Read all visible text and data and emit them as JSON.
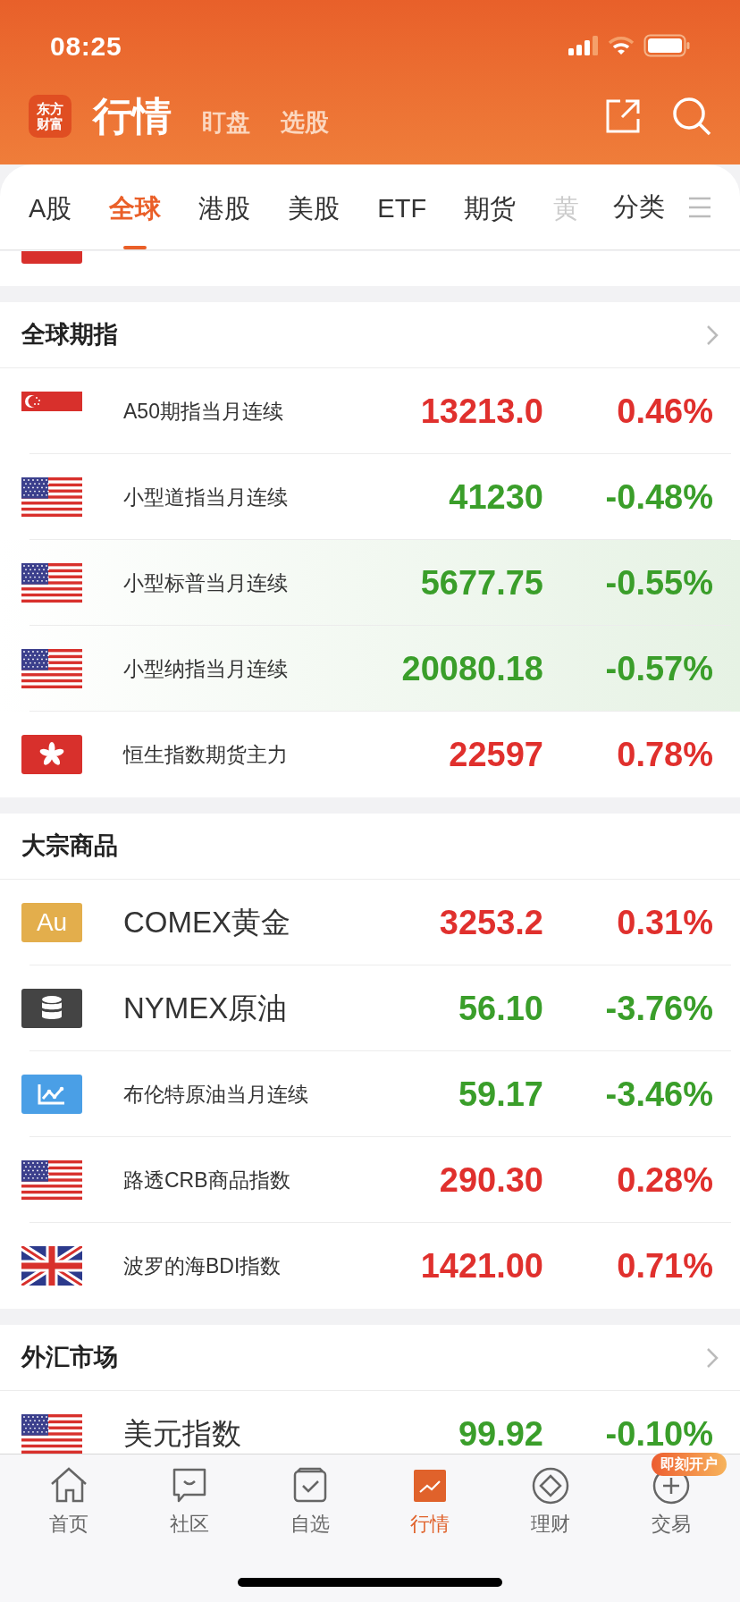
{
  "status_bar": {
    "time": "08:25"
  },
  "header": {
    "logo": [
      "东方",
      "财富"
    ],
    "title": "行情",
    "links": [
      "盯盘",
      "选股"
    ]
  },
  "tabs": [
    {
      "label": "A股",
      "selected": false,
      "faded": false
    },
    {
      "label": "全球",
      "selected": true,
      "faded": false
    },
    {
      "label": "港股",
      "selected": false,
      "faded": false
    },
    {
      "label": "美股",
      "selected": false,
      "faded": false
    },
    {
      "label": "ETF",
      "selected": false,
      "faded": false
    },
    {
      "label": "期货",
      "selected": false,
      "faded": false
    },
    {
      "label": "黄",
      "selected": false,
      "faded": true
    }
  ],
  "category_button": "分类",
  "partial_row": {
    "kind": "flag"
  },
  "sections": [
    {
      "title": "全球期指",
      "has_more": true,
      "rows": [
        {
          "kind": "singapore",
          "name": "A50期指当月连续",
          "price": "13213.0",
          "change": "0.46%",
          "color": "#e0302d",
          "highlighted": false,
          "prominent": false
        },
        {
          "kind": "usa",
          "name": "小型道指当月连续",
          "price": "41230",
          "change": "-0.48%",
          "color": "#3a9e2a",
          "highlighted": false,
          "prominent": false
        },
        {
          "kind": "usa",
          "name": "小型标普当月连续",
          "price": "5677.75",
          "change": "-0.55%",
          "color": "#3a9e2a",
          "highlighted": true,
          "prominent": false
        },
        {
          "kind": "usa",
          "name": "小型纳指当月连续",
          "price": "20080.18",
          "change": "-0.57%",
          "color": "#3a9e2a",
          "highlighted": true,
          "prominent": false
        },
        {
          "kind": "hongkong",
          "name": "恒生指数期货主力",
          "price": "22597",
          "change": "0.78%",
          "color": "#e0302d",
          "highlighted": false,
          "prominent": false
        }
      ]
    },
    {
      "title": "大宗商品",
      "has_more": false,
      "rows": [
        {
          "kind": "symbol",
          "symbol": "Au",
          "name": "COMEX黄金",
          "price": "3253.2",
          "change": "0.31%",
          "color": "#e0302d",
          "highlighted": false,
          "prominent": true
        },
        {
          "kind": "barrel",
          "name": "NYMEX原油",
          "price": "56.10",
          "change": "-3.76%",
          "color": "#3a9e2a",
          "highlighted": false,
          "prominent": true
        },
        {
          "kind": "chart",
          "name": "布伦特原油当月连续",
          "price": "59.17",
          "change": "-3.46%",
          "color": "#3a9e2a",
          "highlighted": false,
          "prominent": false
        },
        {
          "kind": "usa",
          "name": "路透CRB商品指数",
          "price": "290.30",
          "change": "0.28%",
          "color": "#e0302d",
          "highlighted": false,
          "prominent": false
        },
        {
          "kind": "uk",
          "name": "波罗的海BDI指数",
          "price": "1421.00",
          "change": "0.71%",
          "color": "#e0302d",
          "highlighted": false,
          "prominent": false
        }
      ]
    },
    {
      "title": "外汇市场",
      "has_more": true,
      "rows": [
        {
          "kind": "usa",
          "name": "美元指数",
          "price": "99.92",
          "change": "-0.10%",
          "color": "#3a9e2a",
          "highlighted": false,
          "prominent": true
        }
      ]
    }
  ],
  "bottom_nav": [
    {
      "label": "首页",
      "selected": false
    },
    {
      "label": "社区",
      "selected": false
    },
    {
      "label": "自选",
      "selected": false
    },
    {
      "label": "行情",
      "selected": true
    },
    {
      "label": "理财",
      "selected": false
    },
    {
      "label": "交易",
      "selected": false,
      "badge": "即刻开户"
    }
  ]
}
